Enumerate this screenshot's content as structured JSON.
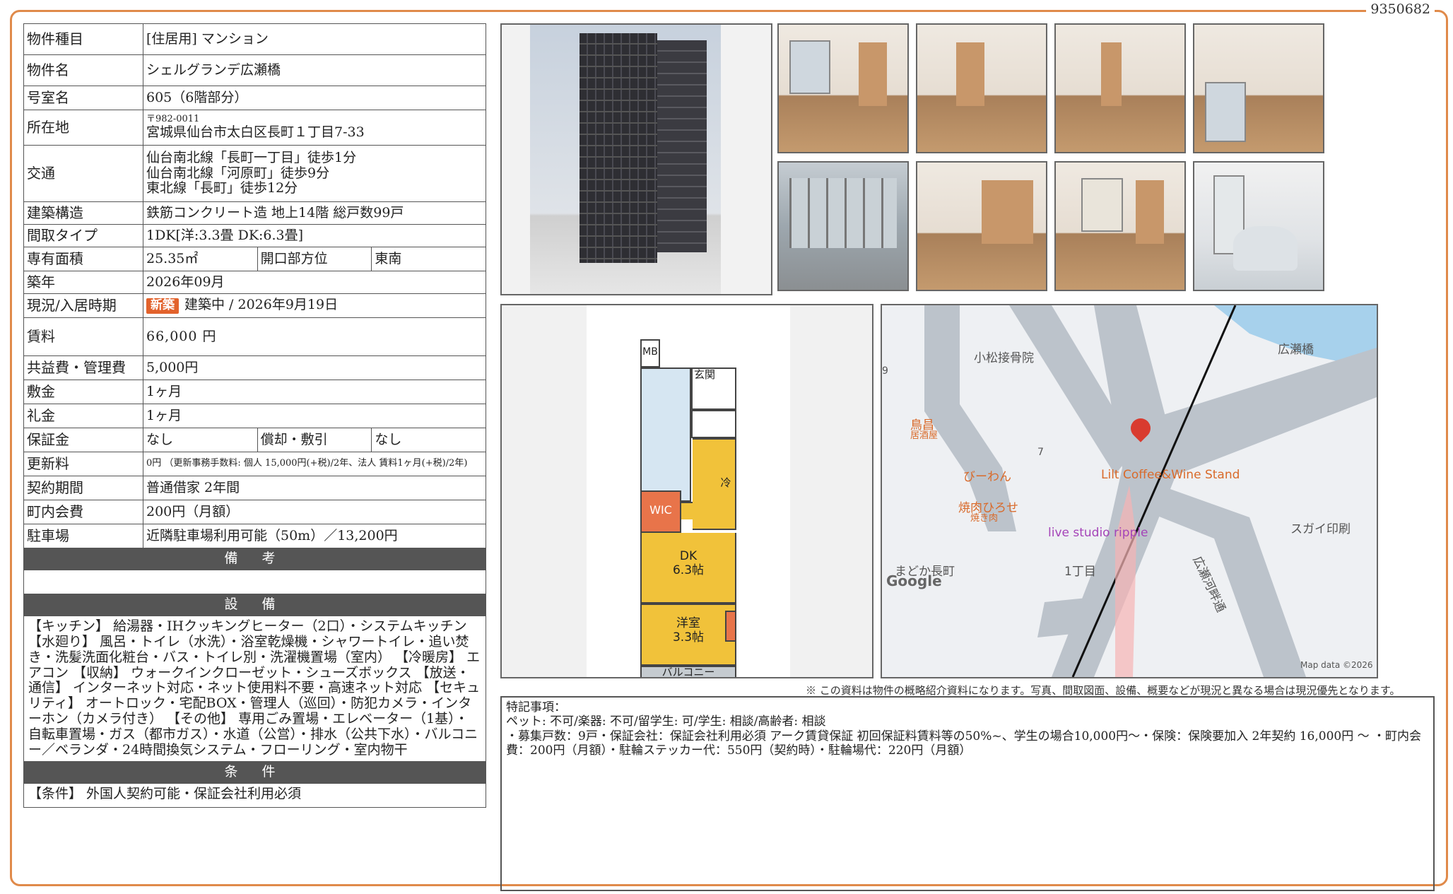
{
  "doc_id": "9350682",
  "property": {
    "type_label": "物件種目",
    "type_value": "[住居用] マンション",
    "name_label": "物件名",
    "name_value": "シェルグランデ広瀬橋",
    "room_label": "号室名",
    "room_value": "605（6階部分）",
    "addr_label": "所在地",
    "addr_zip": "〒982-0011",
    "addr_value": "宮城県仙台市太白区長町１丁目7-33",
    "access_label": "交通",
    "access": [
      "仙台南北線「長町一丁目」徒歩1分",
      "仙台南北線「河原町」徒歩9分",
      "東北線「長町」徒歩12分"
    ],
    "structure_label": "建築構造",
    "structure_value": "鉄筋コンクリート造 地上14階 総戸数99戸",
    "layout_label": "間取タイプ",
    "layout_value": "1DK[洋:3.3畳 DK:6.3畳]",
    "area_label": "専有面積",
    "area_value": "25.35㎡",
    "opening_label": "開口部方位",
    "opening_value": "東南",
    "built_label": "築年",
    "built_value": "2026年09月",
    "status_label": "現況/入居時期",
    "status_badge": "新築",
    "status_value": "建築中 /  2026年9月19日",
    "rent_label": "賃料",
    "rent_value": "66,000 円",
    "fee_label": "共益費・管理費",
    "fee_value": "5,000円",
    "deposit_label": "敷金",
    "deposit_value": "1ヶ月",
    "keymoney_label": "礼金",
    "keymoney_value": "1ヶ月",
    "guarantee_label": "保証金",
    "guarantee_value": "なし",
    "amort_label": "償却・敷引",
    "amort_value": "なし",
    "renewal_label": "更新料",
    "renewal_value": "0円 （更新事務手数料: 個人 15,000円(+税)/2年、法人 賃料1ヶ月(+税)/2年)",
    "contract_label": "契約期間",
    "contract_value": "普通借家 2年間",
    "town_label": "町内会費",
    "town_value": "200円（月額）",
    "parking_label": "駐車場",
    "parking_value": "近隣駐車場利用可能（50m）／13,200円"
  },
  "sections": {
    "remarks_title": "備 考",
    "remarks_text": "",
    "equipment_title": "設 備",
    "equipment_text": "【キッチン】 給湯器・IHクッキングヒーター（2口）・システムキッチン 【水廻り】 風呂・トイレ（水洗）・浴室乾燥機・シャワートイレ・追い焚き・洗髪洗面化粧台・バス・トイレ別・洗濯機置場（室内） 【冷暖房】 エアコン 【収納】 ウォークインクローゼット・シューズボックス 【放送・通信】 インターネット対応・ネット使用料不要・高速ネット対応 【セキュリティ】 オートロック・宅配BOX・管理人（巡回）・防犯カメラ・インターホン（カメラ付き） 【その他】 専用ごみ置場・エレベーター（1基）・自転車置場・ガス（都市ガス）・水道（公営）・排水（公共下水）・バルコニー／ベランダ・24時間換気システム・フローリング・室内物干",
    "conditions_title": "条 件",
    "conditions_text": "【条件】 外国人契約可能・保証会社利用必須"
  },
  "floorplan": {
    "mb": "MB",
    "entrance": "玄関",
    "fridge": "冷",
    "wic": "WIC",
    "dk": "DK",
    "dk_size": "6.3帖",
    "yoshitsu": "洋室",
    "yoshitsu_size": "3.3帖",
    "balcony": "バルコニー"
  },
  "map": {
    "labels": [
      "小松接骨院",
      "広瀬橋",
      "鳥昌",
      "居酒屋",
      "びーわん",
      "Lilt Coffee&Wine Stand",
      "焼肉ひろせ",
      "焼き肉",
      "live studio ripple",
      "スガイ印刷",
      "広瀬河畔通",
      "まどか長町",
      "1丁目",
      "7",
      "9"
    ],
    "google": "Google",
    "mapdata": "Map data ©2026",
    "colors": {
      "road": "#bcc3cb",
      "water": "#a7d1ec",
      "pin": "#d93b2f"
    }
  },
  "disclaimer": "※ この資料は物件の概略紹介資料になります。写真、間取図面、設備、概要などが現況と異なる場合は現況優先となります。",
  "special": {
    "title": "特記事項：",
    "line1": "ペット: 不可/楽器: 不可/留学生: 可/学生: 相談/高齢者: 相談",
    "line2": "・募集戸数：9戸・保証会社：保証会社利用必須 アーク賃貸保証 初回保証料賃料等の50%~、学生の場合10,000円〜・保険：保険要加入 2年契約 16,000円 〜 ・町内会費：200円（月額）・駐輪ステッカー代：550円（契約時）・駐輪場代：220円（月額）"
  },
  "accent_color": "#e08a4a"
}
